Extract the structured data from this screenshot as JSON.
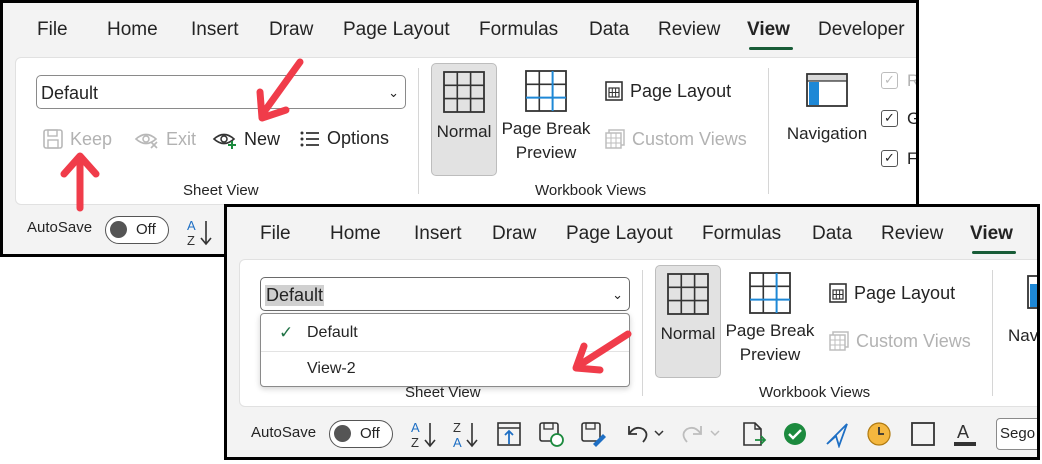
{
  "window_top": {
    "tabs": [
      "File",
      "Home",
      "Insert",
      "Draw",
      "Page Layout",
      "Formulas",
      "Data",
      "Review",
      "View",
      "Developer"
    ],
    "active_tab": "View",
    "sheet_view": {
      "dropdown_value": "Default",
      "keep_label": "Keep",
      "exit_label": "Exit",
      "new_label": "New",
      "options_label": "Options",
      "group_label": "Sheet View"
    },
    "workbook_views": {
      "normal_label": "Normal",
      "page_break_line1": "Page Break",
      "page_break_line2": "Preview",
      "page_layout_label": "Page Layout",
      "custom_views_label": "Custom Views",
      "group_label": "Workbook Views"
    },
    "show": {
      "navigation_label": "Navigation",
      "ruler_label": "R",
      "gridlines_label": "G",
      "formula_label": "F"
    },
    "autosave_label": "AutoSave",
    "autosave_state": "Off"
  },
  "window_bottom": {
    "tabs": [
      "File",
      "Home",
      "Insert",
      "Draw",
      "Page Layout",
      "Formulas",
      "Data",
      "Review",
      "View"
    ],
    "active_tab": "View",
    "sheet_view": {
      "dropdown_value": "Default",
      "menu_items": [
        {
          "label": "Default",
          "checked": true
        },
        {
          "label": "View-2",
          "checked": false
        }
      ],
      "group_label": "Sheet View"
    },
    "workbook_views": {
      "normal_label": "Normal",
      "page_break_line1": "Page Break",
      "page_break_line2": "Preview",
      "page_layout_label": "Page Layout",
      "custom_views_label": "Custom Views",
      "group_label": "Workbook Views"
    },
    "show": {
      "navigation_label": "Nav"
    },
    "autosave_label": "AutoSave",
    "autosave_state": "Off",
    "font_box_value": "Sego"
  },
  "colors": {
    "accent_green": "#185c37",
    "annotation_red": "#f03c4a",
    "check_green": "#217346"
  }
}
